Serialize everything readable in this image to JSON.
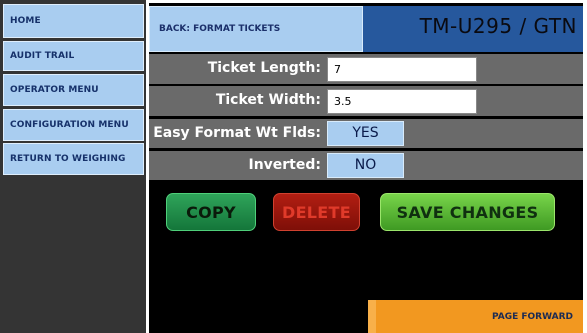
{
  "sidebar": {
    "items": [
      {
        "label": "HOME"
      },
      {
        "label": "AUDIT TRAIL"
      },
      {
        "label": "OPERATOR MENU"
      },
      {
        "label": "CONFIGURATION MENU"
      },
      {
        "label": "RETURN TO WEIGHING"
      }
    ]
  },
  "header": {
    "back_label": "BACK: FORMAT TICKETS",
    "model": "TM-U295 / GTN"
  },
  "form": {
    "ticket_length_label": "Ticket Length:",
    "ticket_length_value": "7",
    "ticket_width_label": "Ticket Width:",
    "ticket_width_value": "3.5",
    "easy_format_label": "Easy Format Wt Flds:",
    "easy_format_value": "YES",
    "inverted_label": "Inverted:",
    "inverted_value": "NO"
  },
  "actions": {
    "copy_label": "COPY",
    "delete_label": "DELETE",
    "save_label": "SAVE CHANGES",
    "page_forward_label": "PAGE FORWARD"
  },
  "colors": {
    "nav_bg": "#a9cdf0",
    "model_bar": "#26589d",
    "copy": "#2fa45a",
    "delete": "#b21e12",
    "save": "#78d44a",
    "page_forward": "#f29820"
  }
}
